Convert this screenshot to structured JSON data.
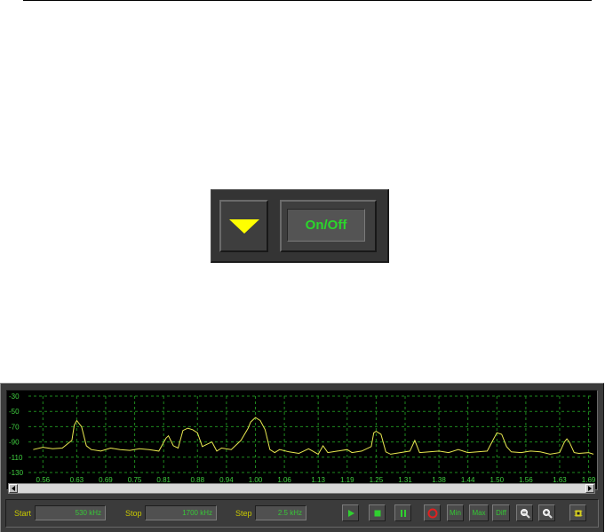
{
  "zoom_panel": {
    "onoff_label": "On/Off",
    "arrow_icon": "triangle-down-icon",
    "arrow_color": "#ffff00"
  },
  "analyzer": {
    "colors": {
      "trace": "#e8e850",
      "grid": "#1e8a1e",
      "labels": "#40d040",
      "field_label": "#c8c800"
    },
    "chart_data": {
      "type": "line",
      "y_ticks": [
        "-30",
        "-50",
        "-70",
        "-90",
        "-110",
        "-130"
      ],
      "ylim": [
        -130,
        -30
      ],
      "x_ticks": [
        "0.56",
        "0.63",
        "0.69",
        "0.75",
        "0.81",
        "0.88",
        "0.94",
        "1.00",
        "1.06",
        "1.13",
        "1.19",
        "1.25",
        "1.31",
        "1.38",
        "1.44",
        "1.50",
        "1.56",
        "1.63",
        "1.69"
      ],
      "xlim": [
        0.53,
        1.7
      ],
      "grid": true,
      "x": [
        0.54,
        0.56,
        0.58,
        0.6,
        0.62,
        0.625,
        0.63,
        0.635,
        0.64,
        0.65,
        0.66,
        0.68,
        0.7,
        0.72,
        0.74,
        0.76,
        0.78,
        0.8,
        0.815,
        0.82,
        0.83,
        0.84,
        0.85,
        0.86,
        0.87,
        0.88,
        0.89,
        0.9,
        0.91,
        0.92,
        0.93,
        0.95,
        0.97,
        0.985,
        0.99,
        1.0,
        1.01,
        1.02,
        1.03,
        1.04,
        1.05,
        1.07,
        1.09,
        1.11,
        1.13,
        1.14,
        1.15,
        1.17,
        1.19,
        1.2,
        1.22,
        1.24,
        1.245,
        1.25,
        1.26,
        1.27,
        1.28,
        1.3,
        1.32,
        1.33,
        1.34,
        1.36,
        1.38,
        1.4,
        1.42,
        1.44,
        1.46,
        1.48,
        1.49,
        1.5,
        1.51,
        1.52,
        1.53,
        1.55,
        1.57,
        1.59,
        1.61,
        1.63,
        1.64,
        1.645,
        1.65,
        1.66,
        1.67,
        1.69,
        1.7
      ],
      "y": [
        -100,
        -97,
        -99,
        -98,
        -88,
        -68,
        -62,
        -66,
        -70,
        -95,
        -100,
        -102,
        -98,
        -100,
        -101,
        -99,
        -100,
        -102,
        -85,
        -82,
        -95,
        -98,
        -75,
        -72,
        -74,
        -78,
        -96,
        -93,
        -90,
        -102,
        -98,
        -100,
        -88,
        -72,
        -64,
        -58,
        -62,
        -74,
        -100,
        -104,
        -100,
        -103,
        -105,
        -99,
        -106,
        -95,
        -104,
        -102,
        -100,
        -104,
        -102,
        -96,
        -78,
        -76,
        -80,
        -103,
        -106,
        -104,
        -102,
        -88,
        -104,
        -103,
        -102,
        -104,
        -100,
        -104,
        -103,
        -102,
        -90,
        -78,
        -80,
        -96,
        -103,
        -104,
        -102,
        -103,
        -106,
        -104,
        -90,
        -86,
        -90,
        -104,
        -105,
        -104,
        -106
      ]
    },
    "controls": {
      "start_label": "Start",
      "start_value": "530 kHz",
      "stop_label": "Stop",
      "stop_value": "1700 kHz",
      "step_label": "Step",
      "step_value": "2.5 kHz",
      "min_label": "Min",
      "max_label": "Max",
      "diff_label": "Diff"
    }
  }
}
